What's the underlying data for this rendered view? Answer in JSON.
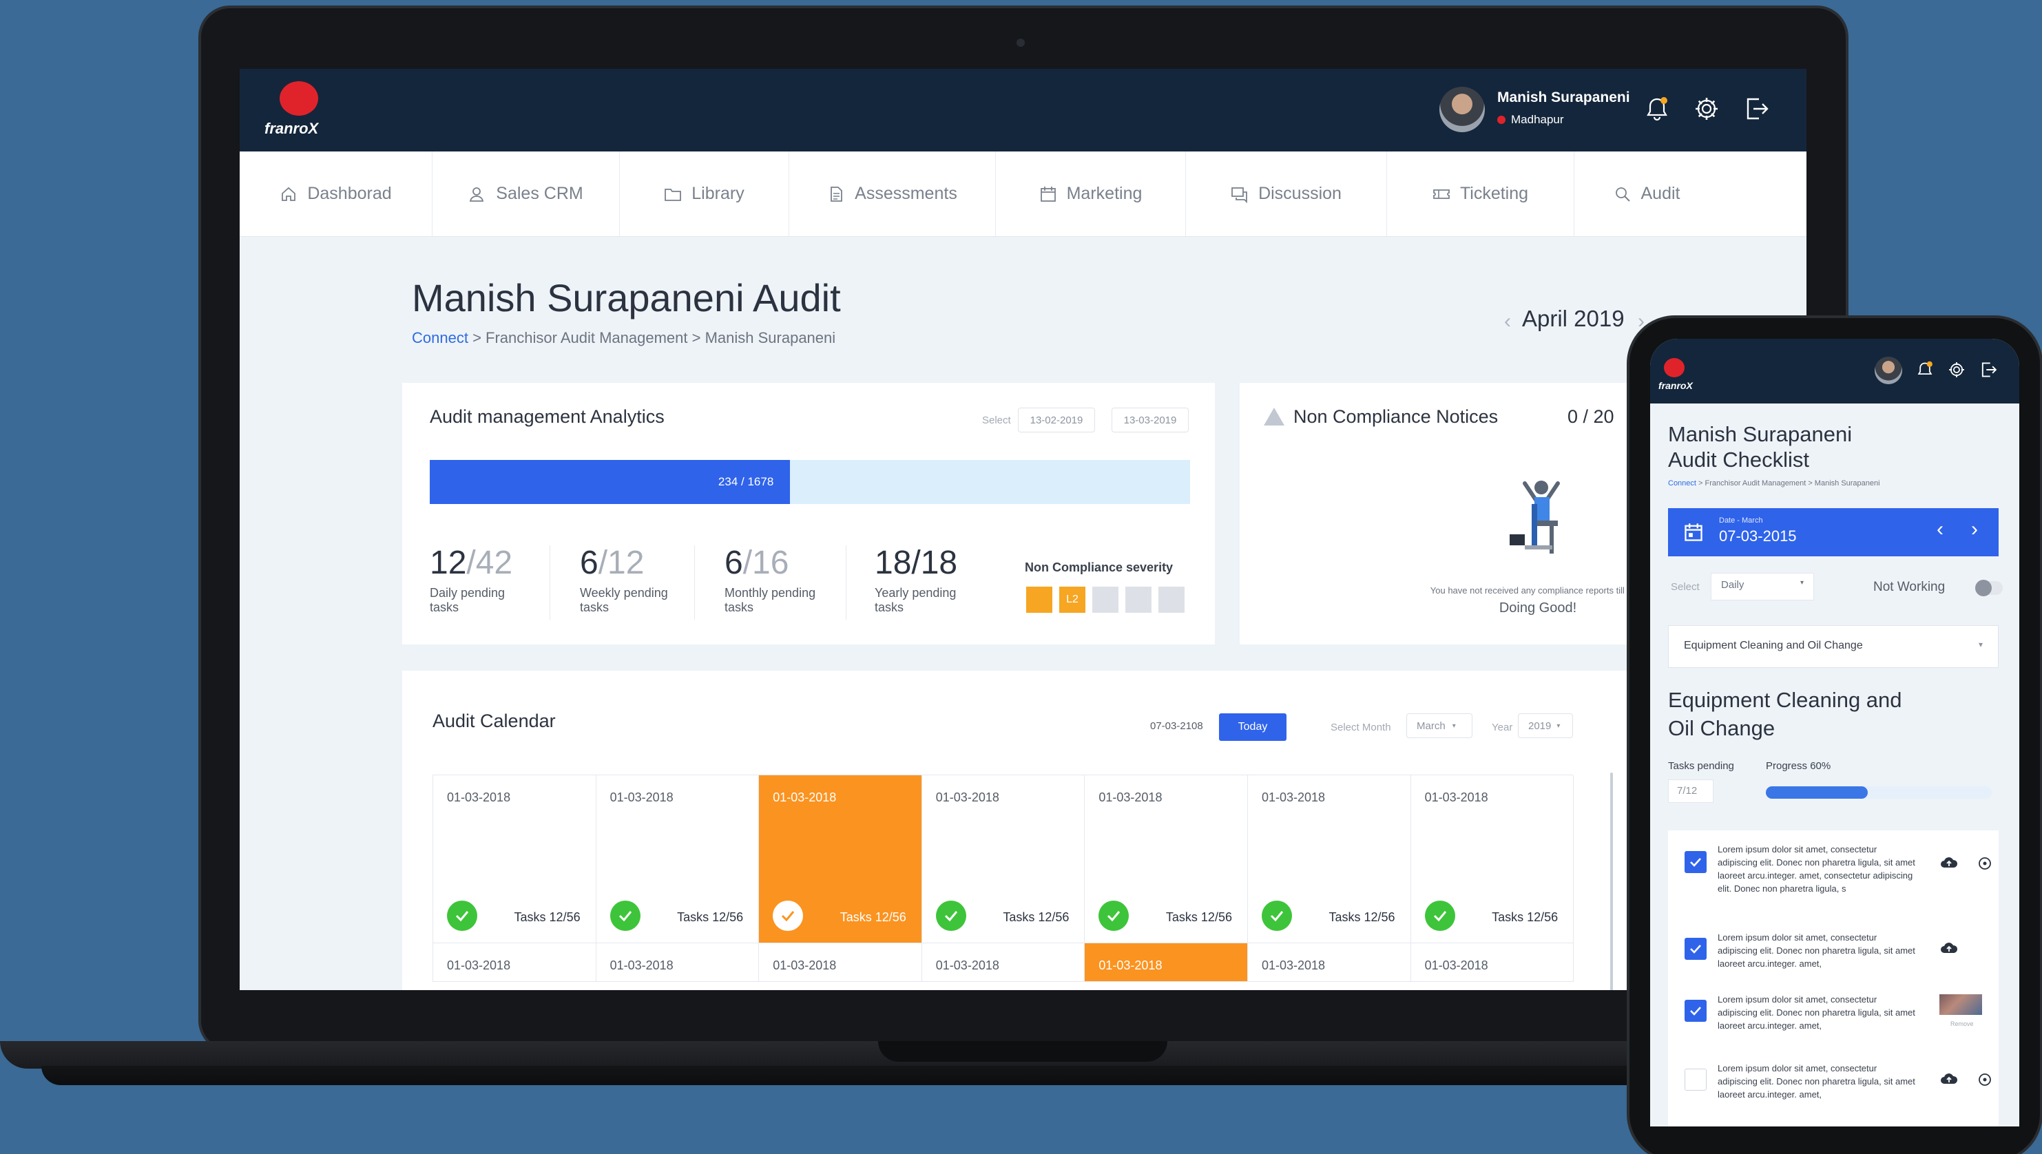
{
  "header": {
    "brand": "franroX",
    "user_name": "Manish Surapaneni",
    "user_location": "Madhapur"
  },
  "nav": [
    {
      "label": "Dashborad",
      "icon": "home-icon"
    },
    {
      "label": "Sales CRM",
      "icon": "user-icon"
    },
    {
      "label": "Library",
      "icon": "folder-icon"
    },
    {
      "label": "Assessments",
      "icon": "document-icon"
    },
    {
      "label": "Marketing",
      "icon": "calendar-icon"
    },
    {
      "label": "Discussion",
      "icon": "chat-icon"
    },
    {
      "label": "Ticketing",
      "icon": "ticket-icon"
    },
    {
      "label": "Audit",
      "icon": "search-icon"
    }
  ],
  "page": {
    "title": "Manish Surapaneni Audit",
    "breadcrumb_link": "Connect",
    "breadcrumb_rest": " > Franchisor Audit Management > Manish Surapaneni",
    "month": "April 2019"
  },
  "analytics": {
    "title": "Audit management Analytics",
    "select_label": "Select",
    "date_from": "13-02-2019",
    "date_to": "13-03-2019",
    "progress_label": "234 / 1678",
    "progress_fraction": 0.474,
    "stats": [
      {
        "num": "12",
        "den": "/42",
        "label1": "Daily pending",
        "label2": "tasks"
      },
      {
        "num": "6",
        "den": "/12",
        "label1": "Weekly pending",
        "label2": "tasks"
      },
      {
        "num": "6",
        "den": "/16",
        "label1": "Monthly pending",
        "label2": "tasks"
      },
      {
        "num": "18/18",
        "den": "",
        "label1": "Yearly pending",
        "label2": "tasks"
      }
    ],
    "severity_title": "Non Compliance severity",
    "severity_level_label": "L2",
    "severity_colors": [
      "#f6a623",
      "#f6a623",
      "#dde1e7",
      "#dde1e7",
      "#dde1e7"
    ]
  },
  "notices": {
    "title": "Non Compliance Notices",
    "count": "0 / 20",
    "message": "You have not received any compliance reports till now.",
    "status": "Doing Good!"
  },
  "calendar": {
    "title": "Audit Calendar",
    "current_date": "07-03-2108",
    "today_label": "Today",
    "select_month_label": "Select Month",
    "month_value": "March",
    "year_label": "Year",
    "year_value": "2019",
    "row1": [
      {
        "date": "01-03-2018",
        "tasks": "Tasks 12/56",
        "highlight": false
      },
      {
        "date": "01-03-2018",
        "tasks": "Tasks 12/56",
        "highlight": false
      },
      {
        "date": "01-03-2018",
        "tasks": "Tasks 12/56",
        "highlight": true
      },
      {
        "date": "01-03-2018",
        "tasks": "Tasks 12/56",
        "highlight": false
      },
      {
        "date": "01-03-2018",
        "tasks": "Tasks 12/56",
        "highlight": false
      },
      {
        "date": "01-03-2018",
        "tasks": "Tasks 12/56",
        "highlight": false
      },
      {
        "date": "01-03-2018",
        "tasks": "Tasks 12/56",
        "highlight": false
      }
    ],
    "row2": [
      {
        "date": "01-03-2018",
        "highlight": false
      },
      {
        "date": "01-03-2018",
        "highlight": false
      },
      {
        "date": "01-03-2018",
        "highlight": false
      },
      {
        "date": "01-03-2018",
        "highlight": false
      },
      {
        "date": "01-03-2018",
        "highlight": true
      },
      {
        "date": "01-03-2018",
        "highlight": false
      },
      {
        "date": "01-03-2018",
        "highlight": false
      }
    ]
  },
  "mobile": {
    "brand": "franroX",
    "title_line1": "Manish Surapaneni",
    "title_line2": "Audit Checklist",
    "breadcrumb_link": "Connect",
    "breadcrumb_rest": " > Franchisor Audit Management > Manish Surapaneni",
    "date_caption": "Date - March",
    "date_value": "07-03-2015",
    "select_label": "Select",
    "select_value": "Daily",
    "not_working_label": "Not Working",
    "dropdown_value": "Equipment Cleaning and Oil Change",
    "section_line1": "Equipment Cleaning and",
    "section_line2": "Oil Change",
    "tasks_pending_label": "Tasks pending",
    "progress_label": "Progress 60%",
    "tasks_value": "7/12",
    "progress_fraction": 0.45,
    "remove_label": "Remove",
    "items": [
      {
        "text": "Lorem ipsum dolor sit amet, consectetur adipiscing elit. Donec non pharetra ligula, sit amet laoreet arcu.integer. amet, consectetur adipiscing elit. Donec non pharetra ligula, s",
        "checked": true
      },
      {
        "text": "Lorem ipsum dolor sit amet, consectetur adipiscing elit. Donec non pharetra ligula, sit amet laoreet arcu.integer. amet,",
        "checked": true
      },
      {
        "text": "Lorem ipsum dolor sit amet, consectetur adipiscing elit. Donec non pharetra ligula, sit amet laoreet arcu.integer. amet,",
        "checked": true
      },
      {
        "text": "Lorem ipsum dolor sit amet, consectetur adipiscing elit. Donec non pharetra ligula, sit amet laoreet arcu.integer. amet,",
        "checked": false
      }
    ]
  },
  "colors": {
    "header_bg": "#14263b",
    "accent_blue": "#2f63ea",
    "highlight_orange": "#fb9320",
    "check_green": "#3ec43a",
    "brand_red": "#e0232b"
  }
}
